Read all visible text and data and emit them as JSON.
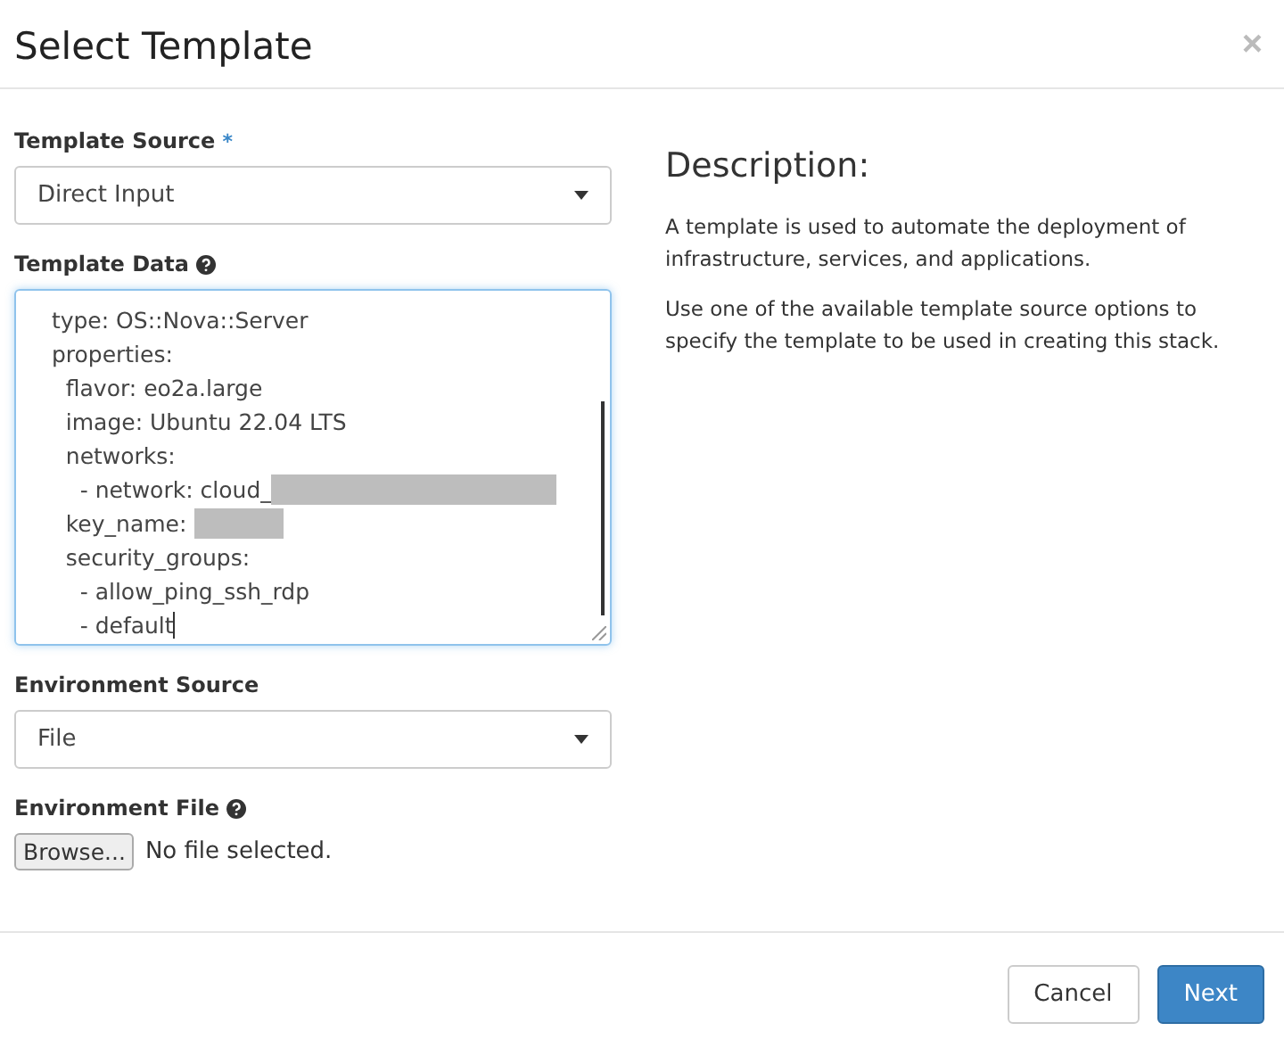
{
  "dialog": {
    "title": "Select Template",
    "close": "×"
  },
  "template_source": {
    "label": "Template Source",
    "required": "*",
    "value": "Direct Input"
  },
  "template_data": {
    "label": "Template Data",
    "lines": [
      {
        "text": "  type: OS::Nova::Server",
        "kind": "plain"
      },
      {
        "text": "  properties:",
        "kind": "plain"
      },
      {
        "text": "    flavor: eo2a.large",
        "kind": "plain"
      },
      {
        "text": "    image: Ubuntu 22.04 LTS",
        "kind": "plain"
      },
      {
        "text": "    networks:",
        "kind": "plain"
      },
      {
        "text": "      - network: cloud_",
        "kind": "redacted-long"
      },
      {
        "text": "    key_name:",
        "kind": "redacted-short"
      },
      {
        "text": "    security_groups:",
        "kind": "plain"
      },
      {
        "text": "      - allow_ping_ssh_rdp",
        "kind": "plain"
      },
      {
        "text": "      - default",
        "kind": "cursor"
      }
    ]
  },
  "environment_source": {
    "label": "Environment Source",
    "value": "File"
  },
  "environment_file": {
    "label": "Environment File",
    "button": "Browse...",
    "status": "No file selected."
  },
  "description": {
    "title": "Description:",
    "paragraphs": [
      "A template is used to automate the deployment of infrastructure, services, and applications.",
      "Use one of the available template source options to specify the template to be used in creating this stack."
    ]
  },
  "buttons": [
    {
      "label": "Cancel",
      "kind": "default"
    },
    {
      "label": "Next",
      "kind": "primary"
    }
  ]
}
